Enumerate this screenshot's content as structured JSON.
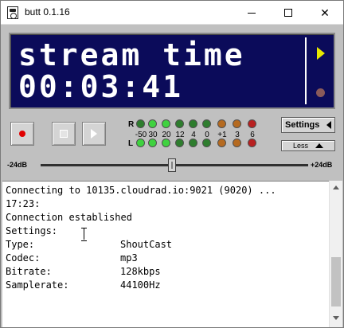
{
  "window": {
    "title": "butt 0.1.16",
    "icons": {
      "app": "speaker-icon",
      "minimize": "minimize-icon",
      "maximize": "maximize-icon",
      "close": "close-icon"
    },
    "close_glyph": "✕"
  },
  "display": {
    "line1": "stream time",
    "line2": "00:03:41",
    "colors": {
      "background": "#0b0b5a",
      "text": "#ffffff",
      "arrow": "#e8e800",
      "dot": "#8a5a5a"
    }
  },
  "transport": {
    "record": "record-icon",
    "stop": "stop-icon",
    "play": "play-icon"
  },
  "vu_meter": {
    "channel_right": "R",
    "channel_left": "L",
    "scale": [
      "-50",
      "30",
      "20",
      "12",
      "4",
      "0",
      "+1",
      "3",
      "6"
    ],
    "right_leds": [
      "g-dim",
      "g-on",
      "g-on",
      "g-dim",
      "g-dim",
      "g-dim",
      "o",
      "o",
      "r"
    ],
    "left_leds": [
      "g-on",
      "g-on",
      "g-on",
      "g-dim",
      "g-dim",
      "g-dim",
      "o",
      "o",
      "r"
    ]
  },
  "controls": {
    "settings_label": "Settings",
    "less_label": "Less"
  },
  "gain": {
    "min_label": "-24dB",
    "max_label": "+24dB",
    "value_fraction": 0.5
  },
  "log": {
    "lines": [
      "Connecting to 10135.cloudrad.io:9021 (9020) ...",
      "17:23:",
      "Connection established",
      "Settings:"
    ],
    "settings": [
      {
        "key": "Type:",
        "value": "ShoutCast"
      },
      {
        "key": "Codec:",
        "value": "mp3"
      },
      {
        "key": "Bitrate:",
        "value": "128kbps"
      },
      {
        "key": "Samplerate:",
        "value": "44100Hz"
      }
    ]
  }
}
